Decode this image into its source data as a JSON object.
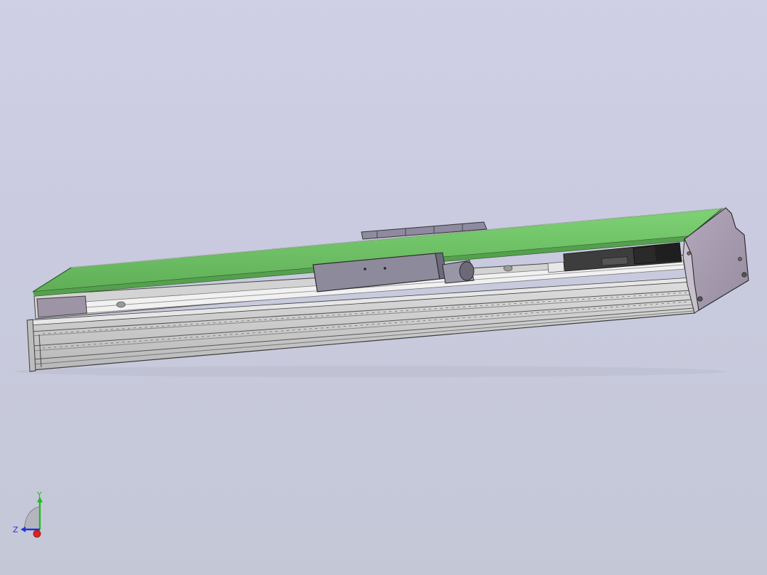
{
  "scene": {
    "background_top": "#cfcfe6",
    "background_bottom": "#c4c8d6",
    "model": {
      "cover_color": "#6fc265",
      "cover_edge_color": "#2e5a2a",
      "profile_color": "#c9c9c9",
      "end_cap_color": "#a89cae",
      "carriage_color": "#8a8a9e",
      "motor_color": "#3a3a3a"
    }
  },
  "triad": {
    "y_label": "Y",
    "z_label": "Z",
    "y_color": "#22bb22",
    "z_color": "#2233dd",
    "x_color": "#dd2222"
  }
}
